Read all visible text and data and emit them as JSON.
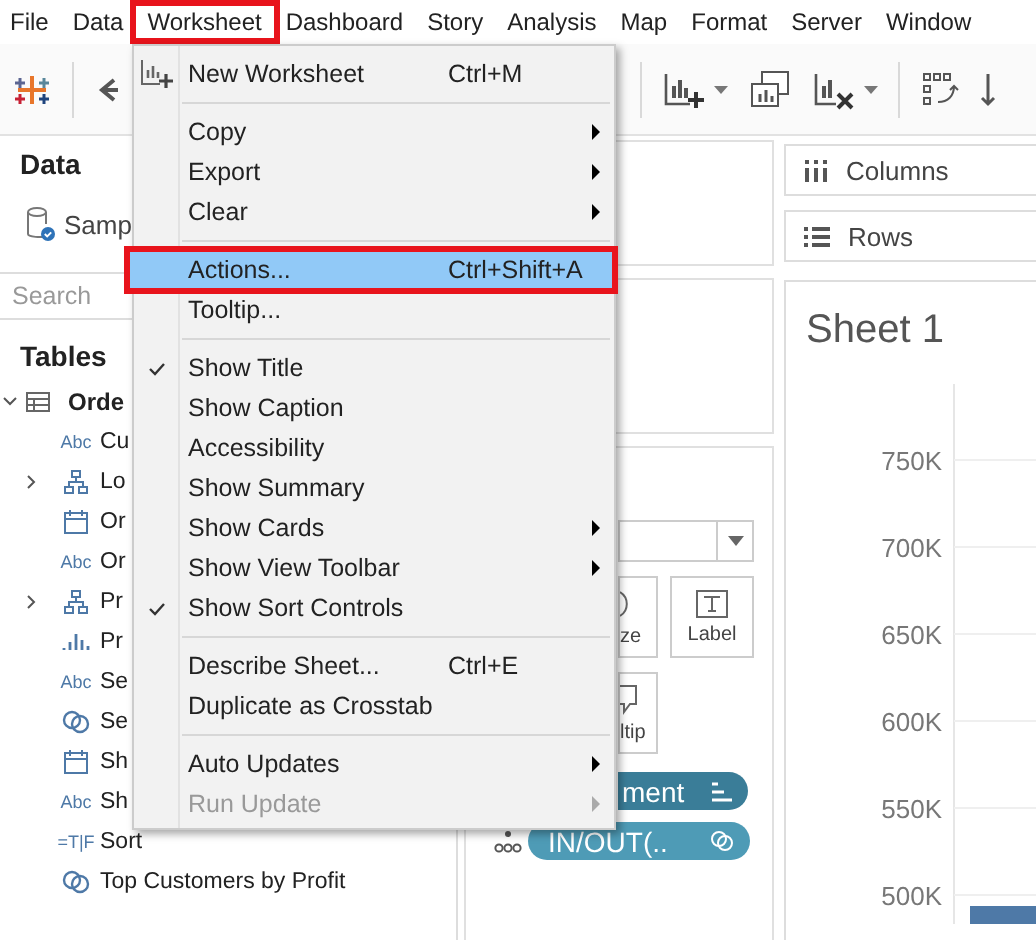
{
  "menubar": [
    {
      "label": "File",
      "annotated": false
    },
    {
      "label": "Data",
      "annotated": false
    },
    {
      "label": "Worksheet",
      "annotated": true
    },
    {
      "label": "Dashboard",
      "annotated": false
    },
    {
      "label": "Story",
      "annotated": false
    },
    {
      "label": "Analysis",
      "annotated": false
    },
    {
      "label": "Map",
      "annotated": false
    },
    {
      "label": "Format",
      "annotated": false
    },
    {
      "label": "Server",
      "annotated": false
    },
    {
      "label": "Window",
      "annotated": false
    }
  ],
  "worksheet_menu": [
    {
      "kind": "icon_item",
      "label": "New Worksheet",
      "shortcut": "Ctrl+M",
      "selected": false,
      "annotated": false
    },
    {
      "kind": "separator"
    },
    {
      "kind": "item",
      "label": "Copy",
      "submenu": true,
      "selected": false,
      "annotated": false
    },
    {
      "kind": "item",
      "label": "Export",
      "submenu": true,
      "selected": false,
      "annotated": false
    },
    {
      "kind": "item",
      "label": "Clear",
      "submenu": true,
      "selected": false,
      "annotated": false
    },
    {
      "kind": "separator"
    },
    {
      "kind": "item",
      "label": "Actions...",
      "shortcut": "Ctrl+Shift+A",
      "selected": true,
      "annotated": true
    },
    {
      "kind": "item",
      "label": "Tooltip...",
      "selected": false,
      "annotated": false
    },
    {
      "kind": "separator"
    },
    {
      "kind": "item",
      "label": "Show Title",
      "checked": true,
      "selected": false,
      "annotated": false
    },
    {
      "kind": "item",
      "label": "Show Caption",
      "checked": false,
      "selected": false,
      "annotated": false
    },
    {
      "kind": "item",
      "label": "Accessibility",
      "selected": false,
      "annotated": false
    },
    {
      "kind": "item",
      "label": "Show Summary",
      "checked": false,
      "selected": false,
      "annotated": false
    },
    {
      "kind": "item",
      "label": "Show Cards",
      "submenu": true,
      "selected": false,
      "annotated": false
    },
    {
      "kind": "item",
      "label": "Show View Toolbar",
      "submenu": true,
      "selected": false,
      "annotated": false
    },
    {
      "kind": "item",
      "label": "Show Sort Controls",
      "checked": true,
      "selected": false,
      "annotated": false
    },
    {
      "kind": "separator"
    },
    {
      "kind": "item",
      "label": "Describe Sheet...",
      "shortcut": "Ctrl+E",
      "selected": false,
      "annotated": false
    },
    {
      "kind": "item",
      "label": "Duplicate as Crosstab",
      "selected": false,
      "annotated": false
    },
    {
      "kind": "separator"
    },
    {
      "kind": "item",
      "label": "Auto Updates",
      "submenu": true,
      "selected": false,
      "annotated": false
    },
    {
      "kind": "item",
      "label": "Run Update",
      "submenu": true,
      "disabled": true,
      "selected": false,
      "annotated": false
    }
  ],
  "data_pane": {
    "title": "Data",
    "data_source": "Samp",
    "search": {
      "placeholder": "Search"
    },
    "tables_title": "Tables",
    "tables": [
      {
        "name": "Orde",
        "expanded": true,
        "children": [
          {
            "kind": "text",
            "badge": "Abc",
            "name": "Cu"
          },
          {
            "kind": "hierarchy",
            "name": "Lo",
            "expanded": false
          },
          {
            "kind": "date",
            "name": "Or"
          },
          {
            "kind": "text",
            "badge": "Abc",
            "name": "Or"
          },
          {
            "kind": "hierarchy",
            "name": "Pr",
            "expanded": false
          },
          {
            "kind": "bin",
            "name": "Pr"
          },
          {
            "kind": "text",
            "badge": "Abc",
            "name": "Se"
          },
          {
            "kind": "set",
            "name": "Se"
          },
          {
            "kind": "date",
            "name": "Sh"
          },
          {
            "kind": "text",
            "badge": "Abc",
            "name": "Sh"
          },
          {
            "kind": "text",
            "badge": "=T|F",
            "name": "Sort"
          },
          {
            "kind": "set",
            "name": "Top Customers by Profit"
          }
        ]
      }
    ]
  },
  "marks_card": {
    "buttons": [
      {
        "kind": "size",
        "label": "ze"
      },
      {
        "kind": "label",
        "label": "Label"
      },
      {
        "kind": "tooltip",
        "label": "ltip"
      }
    ],
    "pills": [
      {
        "kind": "sort",
        "label": "ment"
      },
      {
        "kind": "set",
        "label": "IN/OUT(.."
      }
    ]
  },
  "shelves": [
    {
      "kind": "columns",
      "label": "Columns"
    },
    {
      "kind": "rows",
      "label": "Rows"
    }
  ],
  "sheet": {
    "title": "Sheet 1",
    "axis_labels": [
      "750K",
      "700K",
      "650K",
      "600K",
      "550K",
      "500K"
    ]
  }
}
